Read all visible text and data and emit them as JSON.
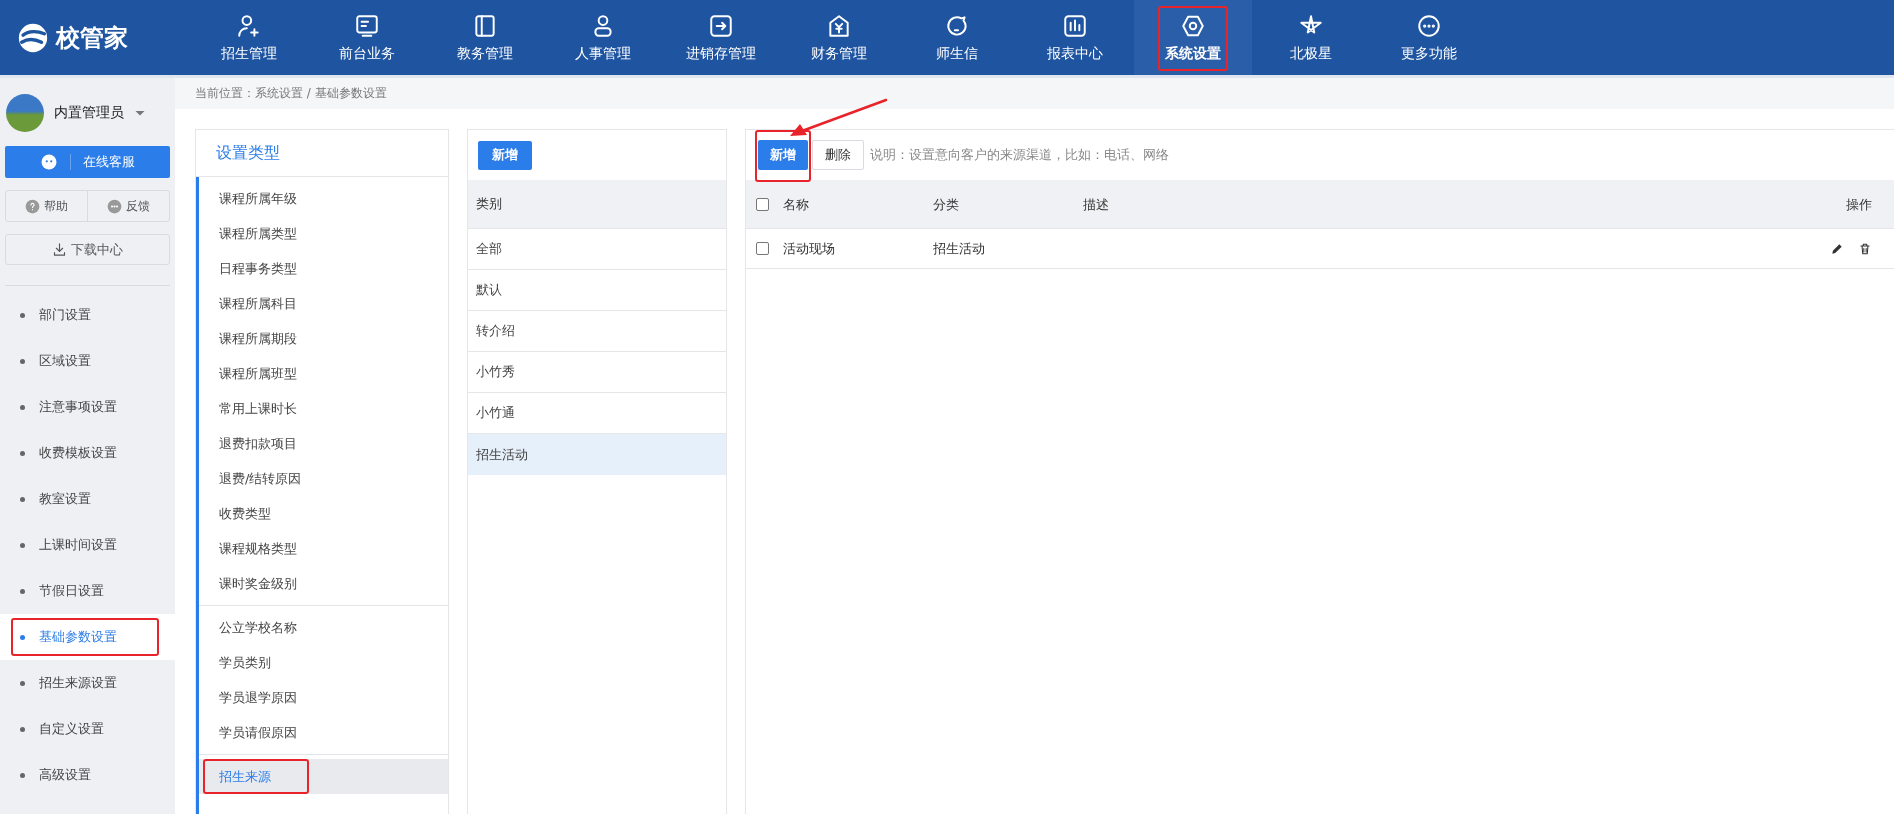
{
  "logo": {
    "text": "校管家"
  },
  "nav": [
    {
      "label": "招生管理",
      "selected": false,
      "annotated": false
    },
    {
      "label": "前台业务",
      "selected": false,
      "annotated": false
    },
    {
      "label": "教务管理",
      "selected": false,
      "annotated": false
    },
    {
      "label": "人事管理",
      "selected": false,
      "annotated": false
    },
    {
      "label": "进销存管理",
      "selected": false,
      "annotated": false
    },
    {
      "label": "财务管理",
      "selected": false,
      "annotated": false
    },
    {
      "label": "师生信",
      "selected": false,
      "annotated": false
    },
    {
      "label": "报表中心",
      "selected": false,
      "annotated": false
    },
    {
      "label": "系统设置",
      "selected": true,
      "annotated": true
    },
    {
      "label": "北极星",
      "selected": false,
      "annotated": false
    },
    {
      "label": "更多功能",
      "selected": false,
      "annotated": false
    }
  ],
  "user": {
    "name": "内置管理员"
  },
  "service_button": {
    "label": "在线客服"
  },
  "help_button": {
    "label": "帮助"
  },
  "feedback_button": {
    "label": "反馈"
  },
  "download_button": {
    "label": "下载中心"
  },
  "side_menu": [
    {
      "label": "部门设置",
      "selected": false,
      "annotated": false
    },
    {
      "label": "区域设置",
      "selected": false,
      "annotated": false
    },
    {
      "label": "注意事项设置",
      "selected": false,
      "annotated": false
    },
    {
      "label": "收费模板设置",
      "selected": false,
      "annotated": false
    },
    {
      "label": "教室设置",
      "selected": false,
      "annotated": false
    },
    {
      "label": "上课时间设置",
      "selected": false,
      "annotated": false
    },
    {
      "label": "节假日设置",
      "selected": false,
      "annotated": false
    },
    {
      "label": "基础参数设置",
      "selected": true,
      "annotated": true
    },
    {
      "label": "招生来源设置",
      "selected": false,
      "annotated": false
    },
    {
      "label": "自定义设置",
      "selected": false,
      "annotated": false
    },
    {
      "label": "高级设置",
      "selected": false,
      "annotated": false
    }
  ],
  "breadcrumb": "当前位置：系统设置 / 基础参数设置",
  "types_panel": {
    "title": "设置类型",
    "groups": [
      [
        {
          "label": "课程所属年级",
          "selected": false,
          "annotated": false
        },
        {
          "label": "课程所属类型",
          "selected": false,
          "annotated": false
        },
        {
          "label": "日程事务类型",
          "selected": false,
          "annotated": false
        },
        {
          "label": "课程所属科目",
          "selected": false,
          "annotated": false
        },
        {
          "label": "课程所属期段",
          "selected": false,
          "annotated": false
        },
        {
          "label": "课程所属班型",
          "selected": false,
          "annotated": false
        },
        {
          "label": "常用上课时长",
          "selected": false,
          "annotated": false
        },
        {
          "label": "退费扣款项目",
          "selected": false,
          "annotated": false
        },
        {
          "label": "退费/结转原因",
          "selected": false,
          "annotated": false
        },
        {
          "label": "收费类型",
          "selected": false,
          "annotated": false
        },
        {
          "label": "课程规格类型",
          "selected": false,
          "annotated": false
        },
        {
          "label": "课时奖金级别",
          "selected": false,
          "annotated": false
        }
      ],
      [
        {
          "label": "公立学校名称",
          "selected": false,
          "annotated": false
        },
        {
          "label": "学员类别",
          "selected": false,
          "annotated": false
        },
        {
          "label": "学员退学原因",
          "selected": false,
          "annotated": false
        },
        {
          "label": "学员请假原因",
          "selected": false,
          "annotated": false
        }
      ],
      [
        {
          "label": "招生来源",
          "selected": true,
          "annotated": true
        }
      ]
    ]
  },
  "category_panel": {
    "add_button": "新增",
    "header": "类别",
    "rows": [
      {
        "label": "全部",
        "selected": false
      },
      {
        "label": "默认",
        "selected": false
      },
      {
        "label": "转介绍",
        "selected": false
      },
      {
        "label": "小竹秀",
        "selected": false
      },
      {
        "label": "小竹通",
        "selected": false
      },
      {
        "label": "招生活动",
        "selected": true
      }
    ]
  },
  "table_panel": {
    "add_button": {
      "label": "新增",
      "annotated": true
    },
    "delete_button": "删除",
    "note": "说明：设置意向客户的来源渠道，比如：电话、网络",
    "columns": [
      "名称",
      "分类",
      "描述",
      "操作"
    ],
    "header_checked": false,
    "rows": [
      {
        "name": "活动现场",
        "category": "招生活动",
        "checked": false
      }
    ]
  }
}
